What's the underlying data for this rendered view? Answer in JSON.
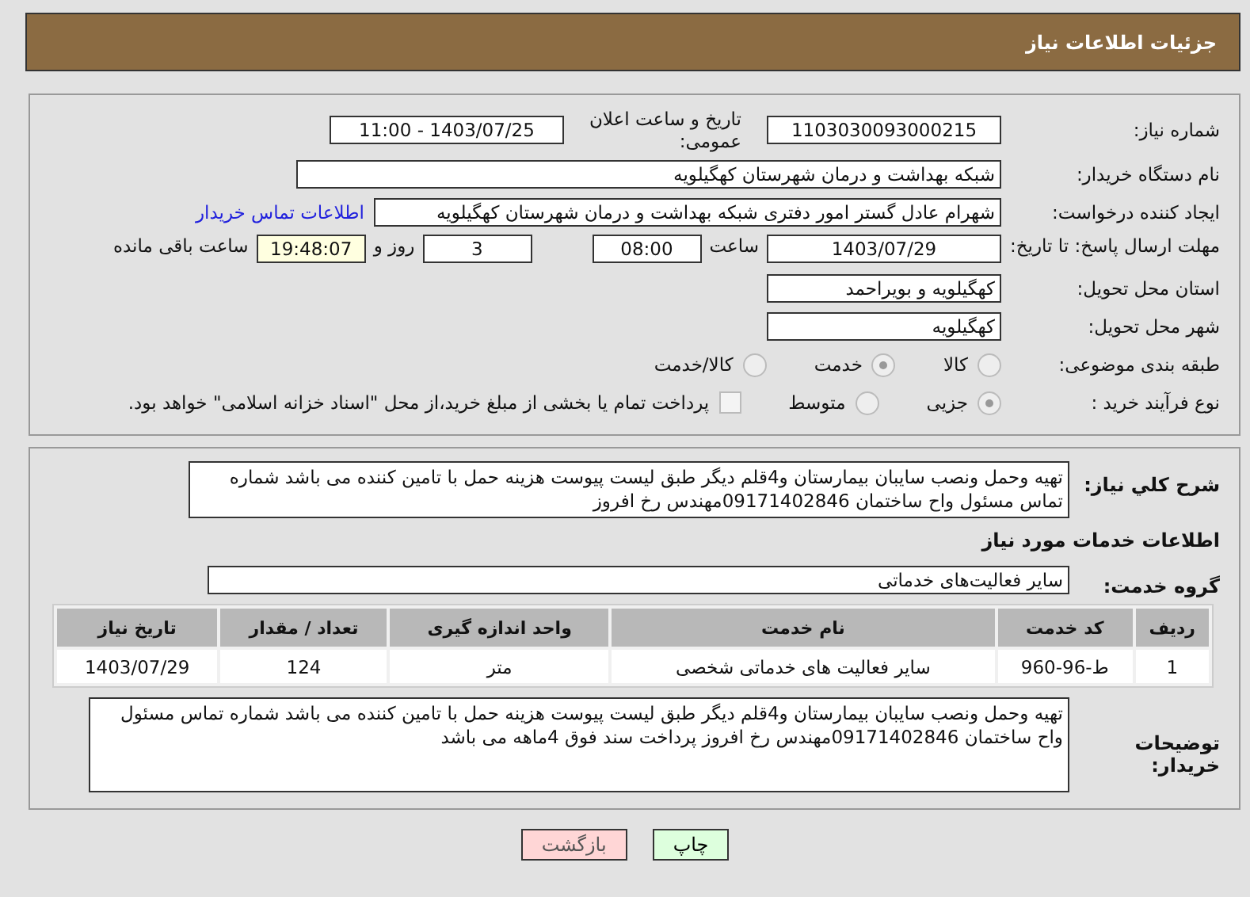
{
  "header": {
    "title": "جزئیات اطلاعات نیاز"
  },
  "info": {
    "need_number_label": "شماره نیاز:",
    "need_number": "1103030093000215",
    "announce_label": "تاریخ و ساعت اعلان عمومی:",
    "announce_value": "1403/07/25 - 11:00",
    "buyer_label": "نام دستگاه خریدار:",
    "buyer": "شبکه بهداشت و درمان شهرستان کهگیلویه",
    "creator_label": "ایجاد کننده درخواست:",
    "creator": "شهرام عادل گستر امور دفتری شبکه بهداشت و درمان شهرستان کهگیلویه",
    "contact_link": "اطلاعات تماس خریدار",
    "deadline_label": "مهلت ارسال پاسخ: تا تاریخ:",
    "deadline_date": "1403/07/29",
    "time_label": "ساعت",
    "deadline_time": "08:00",
    "days": "3",
    "days_label": "روز و",
    "remaining": "19:48:07",
    "remaining_label": "ساعت باقی مانده",
    "province_label": "استان محل تحویل:",
    "province": "کهگیلویه و بویراحمد",
    "city_label": "شهر محل تحویل:",
    "city": "کهگیلویه"
  },
  "category": {
    "label": "طبقه بندی موضوعی:",
    "options": [
      {
        "label": "کالا",
        "selected": false
      },
      {
        "label": "خدمت",
        "selected": true
      },
      {
        "label": "کالا/خدمت",
        "selected": false
      }
    ]
  },
  "process": {
    "label": "نوع فرآیند خرید :",
    "options": [
      {
        "label": "جزیی",
        "selected": true
      },
      {
        "label": "متوسط",
        "selected": false
      }
    ],
    "treasury": {
      "checked": false,
      "label": "پرداخت تمام یا بخشی از مبلغ خرید،از محل \"اسناد خزانه اسلامی\" خواهد بود."
    }
  },
  "description": {
    "label": "شرح کلي نياز:",
    "value": "تهیه وحمل ونصب سایبان بیمارستان  و4قلم دیگر طبق لیست پیوست هزینه حمل با تامین کننده می باشد شماره تماس مسئول واح ساختمان 09171402846مهندس رخ افروز"
  },
  "services_heading": "اطلاعات خدمات مورد نیاز",
  "service_group": {
    "label": "گروه خدمت:",
    "value": "سایر فعالیت‌های خدماتی"
  },
  "table": {
    "columns": [
      "ردیف",
      "کد خدمت",
      "نام خدمت",
      "واحد اندازه گیری",
      "تعداد / مقدار",
      "تاریخ نیاز"
    ],
    "rows": [
      [
        "1",
        "ط-96-960",
        "سایر فعالیت های خدماتی شخصی",
        "متر",
        "124",
        "1403/07/29"
      ]
    ]
  },
  "buyer_notes": {
    "label": "توضیحات خریدار:",
    "value": "تهیه وحمل ونصب سایبان بیمارستان  و4قلم دیگر طبق لیست پیوست هزینه حمل با تامین کننده می باشد شماره تماس مسئول واح ساختمان 09171402846مهندس رخ افروز پرداخت سند فوق 4ماهه می باشد"
  },
  "buttons": [
    {
      "kind": "print",
      "label": "چاپ"
    },
    {
      "kind": "back",
      "label": "بازگشت"
    }
  ]
}
